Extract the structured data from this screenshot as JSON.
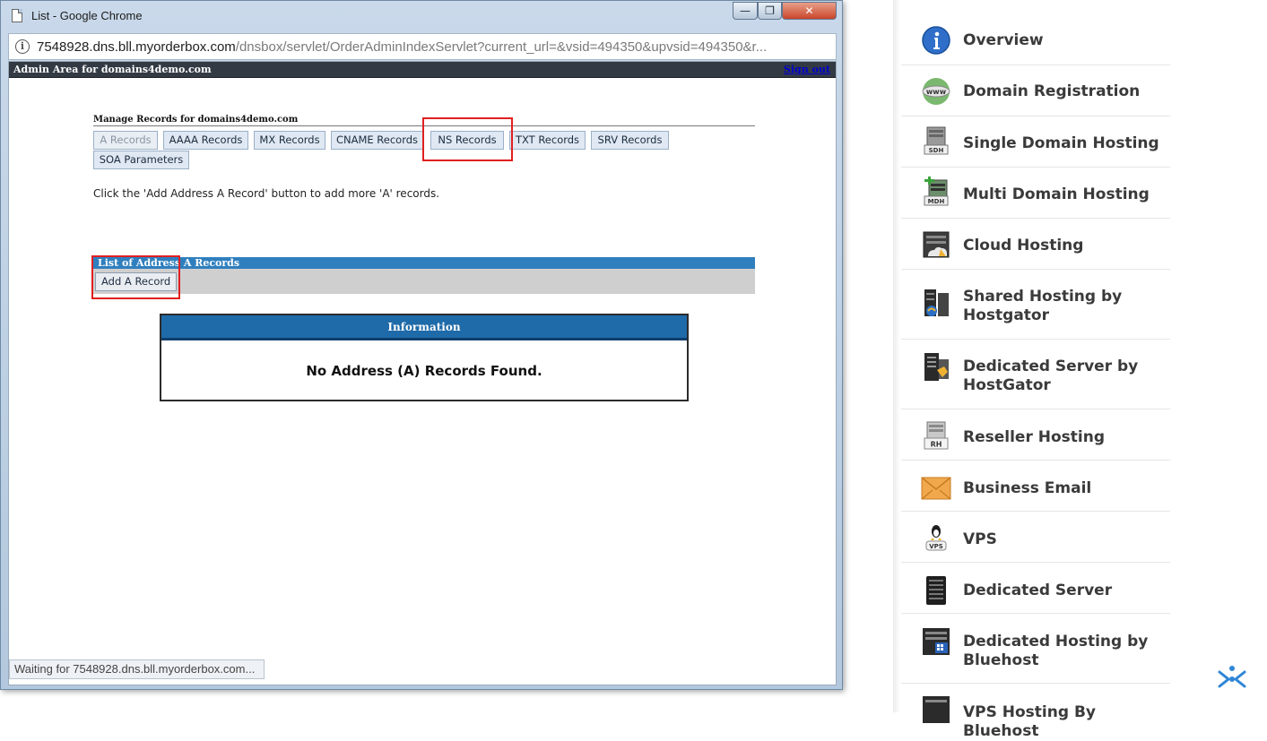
{
  "window": {
    "title": "List - Google Chrome",
    "minimize": "—",
    "maximize": "❐",
    "close": "✕"
  },
  "address_bar": {
    "host": "7548928.dns.bll.myorderbox.com",
    "path": "/dnsbox/servlet/OrderAdminIndexServlet?current_url=&vsid=494350&upvsid=494350&r..."
  },
  "admin_bar": {
    "title": "Admin Area for domains4demo.com",
    "sign_out": "Sign out"
  },
  "manage": {
    "title": "Manage Records for domains4demo.com",
    "tabs": [
      {
        "label": "A Records",
        "active": true
      },
      {
        "label": "AAAA Records"
      },
      {
        "label": "MX Records"
      },
      {
        "label": "CNAME Records"
      },
      {
        "label": "NS Records"
      },
      {
        "label": "TXT Records"
      },
      {
        "label": "SRV Records"
      },
      {
        "label": "SOA Parameters"
      }
    ],
    "help_text": "Click the 'Add Address A Record' button to add more 'A' records."
  },
  "list": {
    "header": "List of Address A Records",
    "add_button": "Add A Record"
  },
  "info_box": {
    "heading": "Information",
    "message": "No Address (A) Records Found."
  },
  "status_bar": "Waiting for 7548928.dns.bll.myorderbox.com...",
  "sidebar": {
    "items": [
      {
        "label": "Overview",
        "icon": "info-icon"
      },
      {
        "label": "Domain Registration",
        "icon": "www-globe-icon"
      },
      {
        "label": "Single Domain Hosting",
        "icon": "sdh-server-icon",
        "badge": "SDH"
      },
      {
        "label": "Multi Domain Hosting",
        "icon": "mdh-server-icon",
        "badge": "MDH"
      },
      {
        "label": "Cloud Hosting",
        "icon": "cloud-hosting-icon"
      },
      {
        "label": "Shared Hosting by Hostgator",
        "icon": "hostgator-server-icon"
      },
      {
        "label": "Dedicated Server by HostGator",
        "icon": "hostgator-dedicated-icon"
      },
      {
        "label": "Reseller Hosting",
        "icon": "rh-server-icon",
        "badge": "RH"
      },
      {
        "label": "Business Email",
        "icon": "envelope-icon"
      },
      {
        "label": "VPS",
        "icon": "vps-linux-icon",
        "badge": "VPS"
      },
      {
        "label": "Dedicated Server",
        "icon": "dedicated-server-icon"
      },
      {
        "label": "Dedicated Hosting by Bluehost",
        "icon": "bluehost-server-icon"
      },
      {
        "label": "VPS Hosting By Bluehost",
        "icon": "bluehost-vps-icon"
      }
    ]
  },
  "colors": {
    "highlight": "#e0201f",
    "list_header": "#2f7fbe",
    "info_header": "#1f6aa8",
    "admin_bar": "#333a44"
  }
}
